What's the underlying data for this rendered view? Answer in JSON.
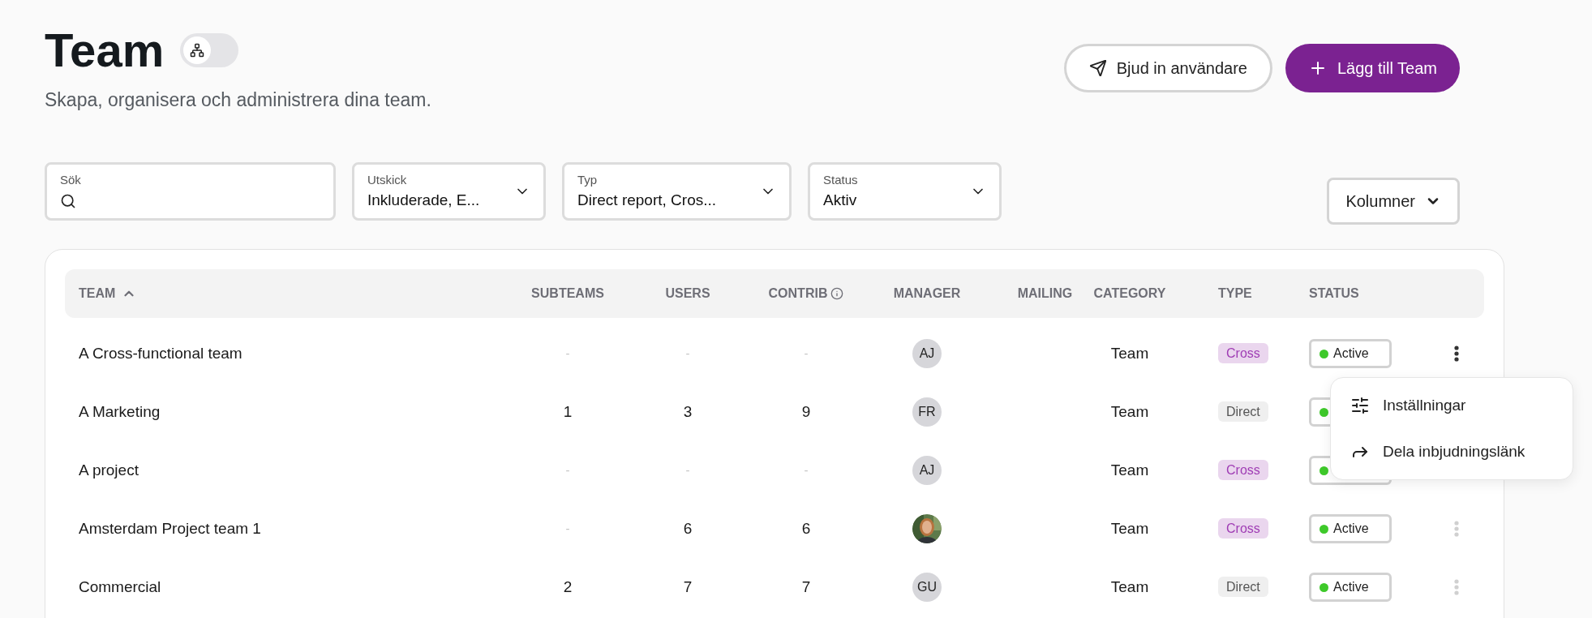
{
  "header": {
    "title": "Team",
    "subtitle": "Skapa, organisera och administrera dina team.",
    "view_toggle": {
      "on": false
    }
  },
  "actions": [
    {
      "kind": "secondary",
      "label": "Bjud in användare"
    },
    {
      "kind": "primary",
      "label": "Lägg till Team"
    }
  ],
  "filters": [
    {
      "kind": "search",
      "label": "Sök"
    },
    {
      "kind": "select",
      "label": "Utskick",
      "value": "Inkluderade, E..."
    },
    {
      "kind": "select",
      "label": "Typ",
      "value": "Direct report, Cros..."
    },
    {
      "kind": "select",
      "label": "Status",
      "value": "Aktiv"
    }
  ],
  "columns_button": {
    "label": "Kolumner"
  },
  "table": {
    "columns": [
      {
        "label": "TEAM",
        "sorted": true
      },
      {
        "label": "SUBTEAMS"
      },
      {
        "label": "USERS"
      },
      {
        "label": "CONTRIB",
        "info": true
      },
      {
        "label": "MANAGER"
      },
      {
        "label": "MAILING"
      },
      {
        "label": "CATEGORY"
      },
      {
        "label": "TYPE"
      },
      {
        "label": "STATUS"
      }
    ],
    "rows": [
      {
        "team": "A Cross-functional team",
        "subteams": "-",
        "users": "-",
        "contrib": "-",
        "manager": {
          "kind": "initials",
          "text": "AJ"
        },
        "category": "Team",
        "type": {
          "kind": "cross",
          "label": "Cross"
        },
        "status": {
          "label": "Active",
          "color": "#3ec92a"
        },
        "menu_open": true
      },
      {
        "team": "A Marketing",
        "subteams": "1",
        "users": "3",
        "contrib": "9",
        "manager": {
          "kind": "initials",
          "text": "FR"
        },
        "category": "Team",
        "type": {
          "kind": "direct",
          "label": "Direct"
        },
        "status": {
          "color": "#3ec92a"
        }
      },
      {
        "team": "A project",
        "subteams": "-",
        "users": "-",
        "contrib": "-",
        "manager": {
          "kind": "initials",
          "text": "AJ"
        },
        "category": "Team",
        "type": {
          "kind": "cross",
          "label": "Cross"
        },
        "status": {
          "color": "#3ec92a"
        }
      },
      {
        "team": "Amsterdam Project team 1",
        "subteams": "-",
        "users": "6",
        "contrib": "6",
        "category": "Team",
        "type": {
          "kind": "cross",
          "label": "Cross"
        },
        "status": {
          "label": "Active",
          "color": "#3ec92a"
        },
        "menu_open": false
      },
      {
        "team": "Commercial",
        "subteams": "2",
        "users": "7",
        "contrib": "7",
        "manager": {
          "kind": "initials",
          "text": "GU"
        },
        "category": "Team",
        "type": {
          "kind": "direct",
          "label": "Direct"
        },
        "status": {
          "label": "Active",
          "color": "#3ec92a"
        },
        "menu_open": false
      }
    ]
  },
  "row_menu": {
    "items": [
      {
        "kind": "settings",
        "label": "Inställningar"
      },
      {
        "kind": "share",
        "label": "Dela inbjudningslänk"
      }
    ]
  }
}
